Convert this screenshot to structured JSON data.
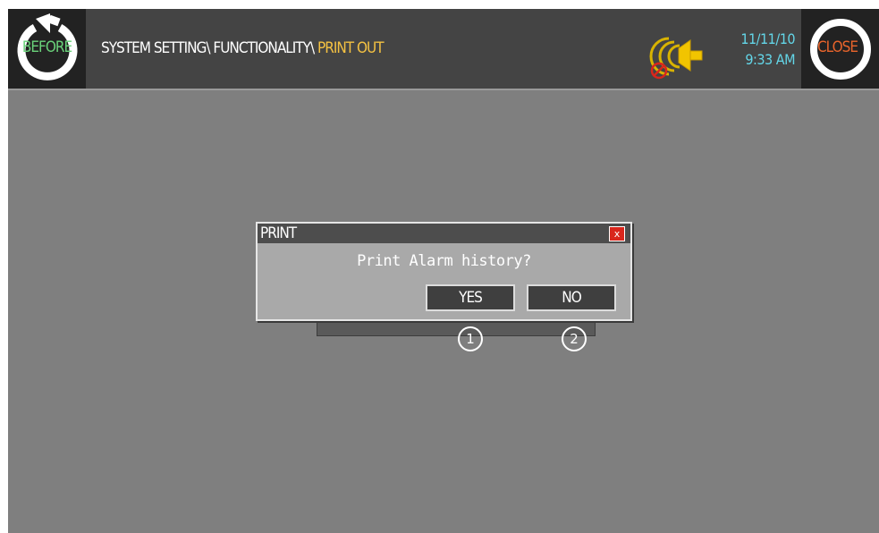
{
  "header": {
    "before_label": "BEFORE",
    "close_label": "CLOSE",
    "breadcrumb": {
      "part1": "SYSTEM SETTING\\",
      "part2": "FUNCTIONALITY\\",
      "current": "PRINT OUT"
    },
    "date": "11/11/10",
    "time": "9:33 AM"
  },
  "dialog": {
    "title": "PRINT",
    "close_glyph": "x",
    "message": "Print Alarm history?",
    "yes_label": "YES",
    "no_label": "NO"
  },
  "markers": [
    "1",
    "2"
  ],
  "colors": {
    "background": "#7f7f7f",
    "topbar": "#444444",
    "breadcrumb_current": "#f5c242",
    "datetime": "#63d6e8",
    "before_text": "#6ad27a",
    "close_text": "#e9642b",
    "dialog_close": "#d9261c"
  },
  "icons": [
    "back-arrow-icon",
    "alarm-bell-icon",
    "alarm-disabled-icon"
  ]
}
